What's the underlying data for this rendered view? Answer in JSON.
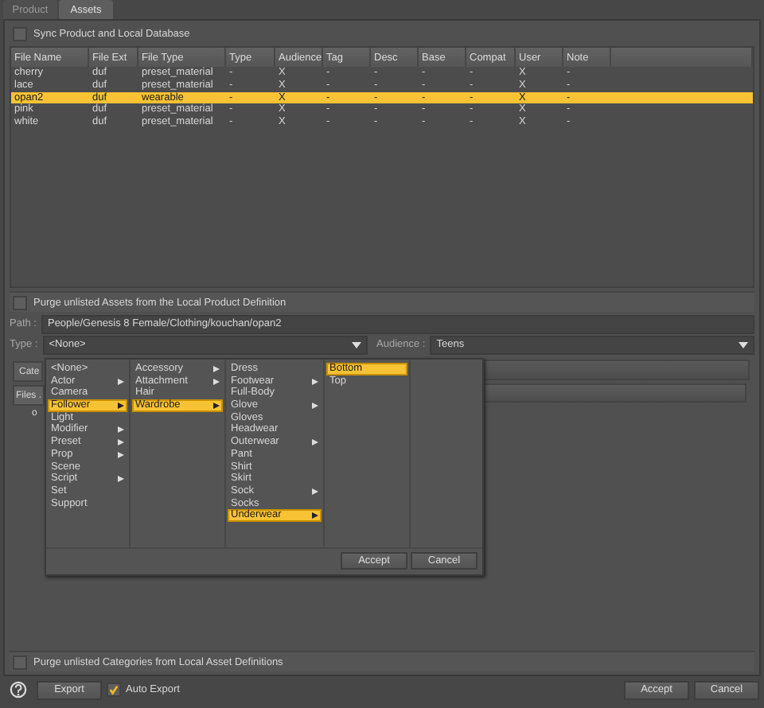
{
  "tabs": [
    {
      "label": "Product",
      "selected": false
    },
    {
      "label": "Assets",
      "selected": true
    }
  ],
  "sync_checkbox": {
    "label": "Sync Product and Local Database",
    "checked": false
  },
  "table": {
    "columns": [
      "File Name",
      "File Ext",
      "File Type",
      "Type",
      "Audience",
      "Tag",
      "Desc",
      "Base",
      "Compat",
      "User",
      "Note"
    ],
    "rows": [
      {
        "cells": [
          "cherry",
          "duf",
          "preset_material",
          "-",
          "X",
          "-",
          "-",
          "-",
          "-",
          "X",
          "-"
        ],
        "selected": false
      },
      {
        "cells": [
          "lace",
          "duf",
          "preset_material",
          "-",
          "X",
          "-",
          "-",
          "-",
          "-",
          "X",
          "-"
        ],
        "selected": false
      },
      {
        "cells": [
          "opan2",
          "duf",
          "wearable",
          "-",
          "X",
          "-",
          "-",
          "-",
          "-",
          "X",
          "-"
        ],
        "selected": true
      },
      {
        "cells": [
          "pink",
          "duf",
          "preset_material",
          "-",
          "X",
          "-",
          "-",
          "-",
          "-",
          "X",
          "-"
        ],
        "selected": false
      },
      {
        "cells": [
          "white",
          "duf",
          "preset_material",
          "-",
          "X",
          "-",
          "-",
          "-",
          "-",
          "X",
          "-"
        ],
        "selected": false
      }
    ]
  },
  "purge_assets": {
    "label": "Purge unlisted Assets from the Local Product Definition",
    "checked": false
  },
  "path": {
    "label": "Path :",
    "value": "People/Genesis 8 Female/Clothing/kouchan/opan2"
  },
  "type": {
    "label": "Type :",
    "value": "<None>"
  },
  "audience": {
    "label": "Audience :",
    "value": "Teens"
  },
  "behind": {
    "tab": "Cate",
    "button": "Files .",
    "text": "o"
  },
  "popup": {
    "columns": [
      [
        {
          "label": "<None>",
          "submenu": false,
          "selected": false
        },
        {
          "label": "Actor",
          "submenu": true,
          "selected": false
        },
        {
          "label": "Camera",
          "submenu": false,
          "selected": false
        },
        {
          "label": "Follower",
          "submenu": true,
          "selected": true
        },
        {
          "label": "Light",
          "submenu": false,
          "selected": false
        },
        {
          "label": "Modifier",
          "submenu": true,
          "selected": false
        },
        {
          "label": "Preset",
          "submenu": true,
          "selected": false
        },
        {
          "label": "Prop",
          "submenu": true,
          "selected": false
        },
        {
          "label": "Scene",
          "submenu": false,
          "selected": false
        },
        {
          "label": "Script",
          "submenu": true,
          "selected": false
        },
        {
          "label": "Set",
          "submenu": false,
          "selected": false
        },
        {
          "label": "Support",
          "submenu": false,
          "selected": false
        }
      ],
      [
        {
          "label": "Accessory",
          "submenu": true,
          "selected": false
        },
        {
          "label": "Attachment",
          "submenu": true,
          "selected": false
        },
        {
          "label": "Hair",
          "submenu": false,
          "selected": false
        },
        {
          "label": "Wardrobe",
          "submenu": true,
          "selected": true
        }
      ],
      [
        {
          "label": "Dress",
          "submenu": false,
          "selected": false
        },
        {
          "label": "Footwear",
          "submenu": true,
          "selected": false
        },
        {
          "label": "Full-Body",
          "submenu": false,
          "selected": false
        },
        {
          "label": "Glove",
          "submenu": true,
          "selected": false
        },
        {
          "label": "Gloves",
          "submenu": false,
          "selected": false
        },
        {
          "label": "Headwear",
          "submenu": false,
          "selected": false
        },
        {
          "label": "Outerwear",
          "submenu": true,
          "selected": false
        },
        {
          "label": "Pant",
          "submenu": false,
          "selected": false
        },
        {
          "label": "Shirt",
          "submenu": false,
          "selected": false
        },
        {
          "label": "Skirt",
          "submenu": false,
          "selected": false
        },
        {
          "label": "Sock",
          "submenu": true,
          "selected": false
        },
        {
          "label": "Socks",
          "submenu": false,
          "selected": false
        },
        {
          "label": "Underwear",
          "submenu": true,
          "selected": true
        }
      ],
      [
        {
          "label": "Bottom",
          "submenu": false,
          "selected": true
        },
        {
          "label": "Top",
          "submenu": false,
          "selected": false
        }
      ]
    ],
    "buttons": [
      "Accept",
      "Cancel"
    ]
  },
  "purge_categories": {
    "label": "Purge unlisted Categories from Local Asset Definitions",
    "checked": false
  },
  "footer": {
    "export": "Export",
    "auto_export": {
      "label": "Auto Export",
      "checked": true
    },
    "buttons": [
      "Accept",
      "Cancel"
    ]
  }
}
